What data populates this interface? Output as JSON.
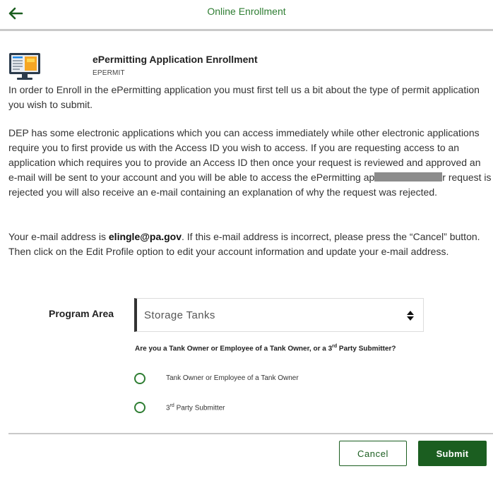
{
  "header": {
    "title": "Online Enrollment",
    "back_icon": "arrow-left-icon",
    "title_color": "#2e7d32"
  },
  "app": {
    "icon": "monitor-icon",
    "title": "ePermitting Application Enrollment",
    "code": "EPERMIT"
  },
  "content": {
    "p1": "In order to Enroll in the ePermitting application you must first tell us a bit about the type of permit application you wish to submit.",
    "p2_before": "DEP has some electronic applications which you can access immediately while other electronic applications require you to first provide us with the Access ID you wish to access. If you are requesting access to an application which requires you to provide an Access ID then once your request is reviewed and approved an e-mail will be sent to your account and you will be able to access the ePermitting ap",
    "p2_after": "r request is rejected you will also receive an e-mail containing an explanation of why the request was rejected.",
    "p3_before": "Your e-mail address is ",
    "email": "elingle@pa.gov",
    "p3_after": ". If this e-mail address is incorrect, please press the “Cancel” button. Then click on the Edit Profile option to edit your account information and update your e-mail address."
  },
  "form": {
    "program_area_label": "Program Area",
    "program_area_value": "Storage Tanks",
    "question_before": "Are you a Tank Owner or Employee of a Tank Owner, or a 3",
    "question_sup": "rd",
    "question_after": " Party Submitter?",
    "option1": "Tank Owner or Employee of a Tank Owner",
    "option2_num": "3",
    "option2_sup": "rd",
    "option2_rest": " Party Submitter"
  },
  "buttons": {
    "cancel": "Cancel",
    "submit": "Submit",
    "accent": "#1b5e20"
  }
}
